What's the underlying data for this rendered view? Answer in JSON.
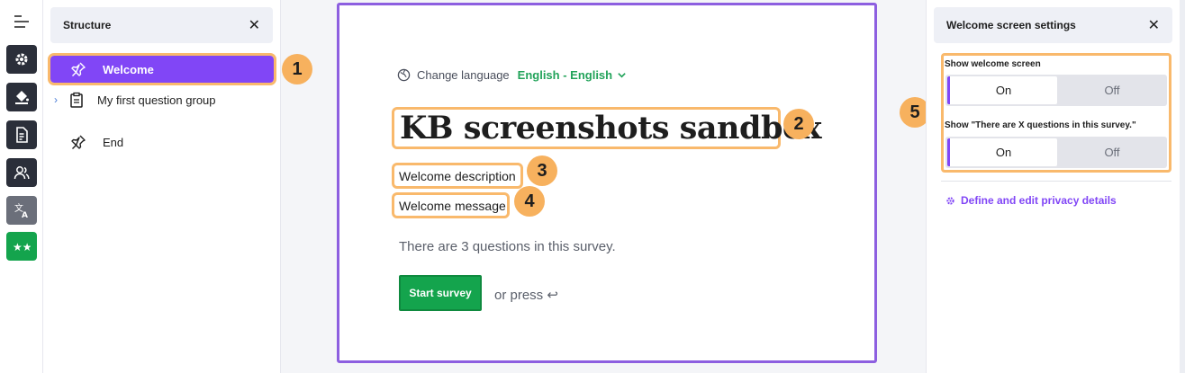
{
  "structure": {
    "title": "Structure",
    "close": "✕",
    "items": [
      {
        "label": "Welcome"
      },
      {
        "label": "My first question group"
      },
      {
        "label": "End"
      }
    ]
  },
  "preview": {
    "change_language": "Change language",
    "language_value": "English - English",
    "survey_title": "KB screenshots sandbox",
    "welcome_description": "Welcome description",
    "welcome_message": "Welcome message",
    "question_count_text": "There are 3 questions in this survey.",
    "start_button": "Start survey",
    "or_press": "or press ↩"
  },
  "settings": {
    "title": "Welcome screen settings",
    "close": "✕",
    "show_welcome_label": "Show welcome screen",
    "show_welcome_on": "On",
    "show_welcome_off": "Off",
    "show_count_label": "Show \"There are X questions in this survey.\"",
    "show_count_on": "On",
    "show_count_off": "Off",
    "privacy_link": "Define and edit privacy details"
  },
  "badges": [
    "1",
    "2",
    "3",
    "4",
    "5"
  ],
  "colors": {
    "accent": "#8146f6",
    "highlight": "#f9b96c",
    "badge": "#f7b15e",
    "start_button": "#14a44d",
    "language": "#22a35a"
  }
}
